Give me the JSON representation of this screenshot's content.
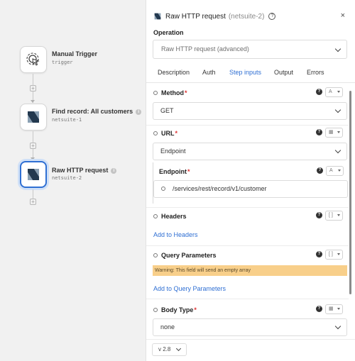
{
  "workflow": {
    "nodes": [
      {
        "title": "Manual Trigger",
        "sub": "trigger",
        "icon": "manual-trigger-icon",
        "info": false
      },
      {
        "title": "Find record: All customers",
        "sub": "netsuite-1",
        "icon": "netsuite-logo-icon",
        "info": true
      },
      {
        "title": "Raw HTTP request",
        "sub": "netsuite-2",
        "icon": "netsuite-logo-icon",
        "info": true,
        "selected": true
      }
    ]
  },
  "panel": {
    "title": "Raw HTTP request",
    "subtitle": "(netsuite-2)",
    "help": "?",
    "close": "×",
    "operation_label": "Operation",
    "operation_value": "Raw HTTP request (advanced)",
    "tabs": [
      "Description",
      "Auth",
      "Step inputs",
      "Output",
      "Errors"
    ],
    "active_tab": "Step inputs",
    "fields": {
      "method": {
        "label": "Method",
        "value": "GET",
        "type": "A"
      },
      "url": {
        "label": "URL",
        "value": "Endpoint"
      },
      "endpoint": {
        "label": "Endpoint",
        "value": "/services/rest/record/v1/customer",
        "type": "A"
      },
      "headers": {
        "label": "Headers",
        "type": "[ ]",
        "add": "Add to Headers"
      },
      "query": {
        "label": "Query Parameters",
        "type": "[ ]",
        "warning": "Warning: This field will send an empty array",
        "add": "Add to Query Parameters"
      },
      "body_type": {
        "label": "Body Type",
        "value": "none"
      }
    },
    "version": "v 2.8"
  },
  "colors": {
    "accent": "#2f6fd3",
    "warning": "#f8cf8a",
    "required": "#d33333"
  }
}
